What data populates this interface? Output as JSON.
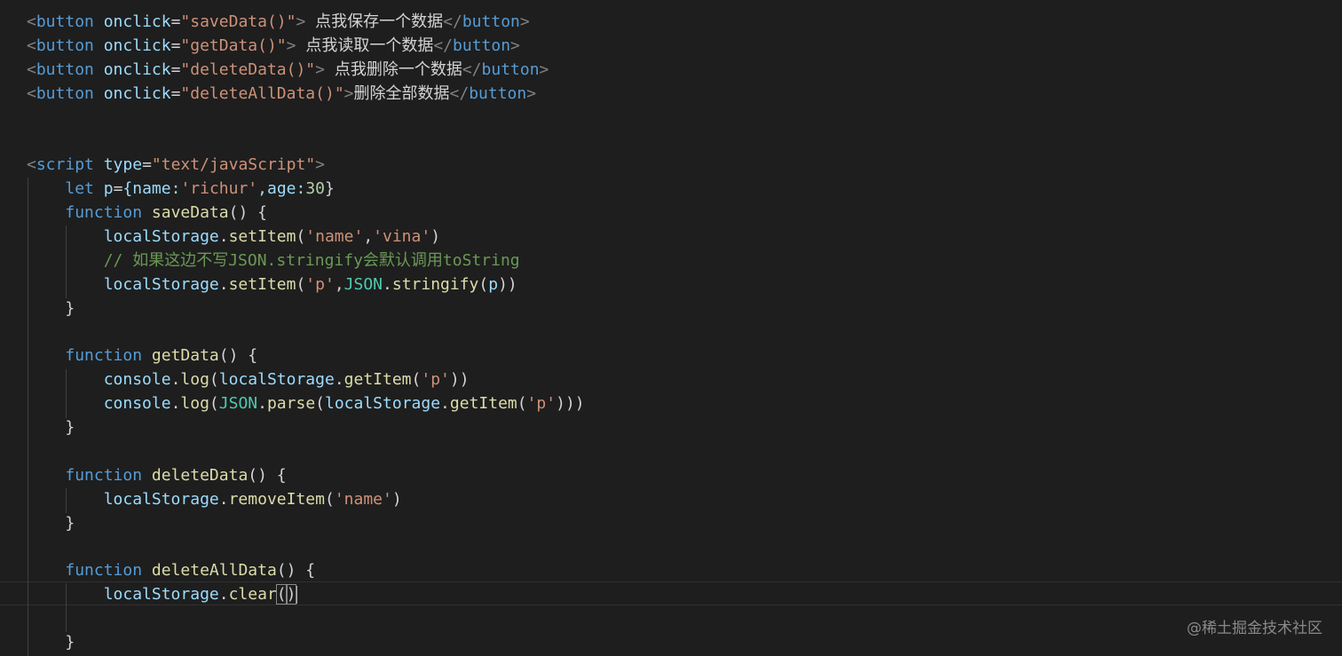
{
  "html_lines": [
    {
      "attr": "onclick",
      "value": "\"saveData()\"",
      "text": " 点我保存一个数据"
    },
    {
      "attr": "onclick",
      "value": "\"getData()\"",
      "text": " 点我读取一个数据"
    },
    {
      "attr": "onclick",
      "value": "\"deleteData()\"",
      "text": " 点我删除一个数据"
    },
    {
      "attr": "onclick",
      "value": "\"deleteAllData()\"",
      "text": "删除全部数据"
    }
  ],
  "tags": {
    "button": "button",
    "script": "script",
    "type_attr": "type",
    "type_value": "\"text/javaScript\""
  },
  "script": {
    "let_kw": "let",
    "p_var": "p",
    "obj": "{name:",
    "name_val": "'richur'",
    "age_key": ",age:",
    "age_val": "30",
    "obj_close": "}",
    "function_kw": "function",
    "save_fn": "saveData",
    "get_fn": "getData",
    "delete_fn": "deleteData",
    "delete_all_fn": "deleteAllData",
    "local_storage": "localStorage",
    "set_item": "setItem",
    "get_item": "getItem",
    "remove_item": "removeItem",
    "clear_fn": "clear",
    "console": "console",
    "log_fn": "log",
    "json_cls": "JSON",
    "stringify_fn": "stringify",
    "parse_fn": "parse",
    "str_name": "'name'",
    "str_vina": "'vina'",
    "str_p": "'p'",
    "comment": "// 如果这边不写JSON.stringify会默认调用toString"
  },
  "watermark": "@稀土掘金技术社区"
}
